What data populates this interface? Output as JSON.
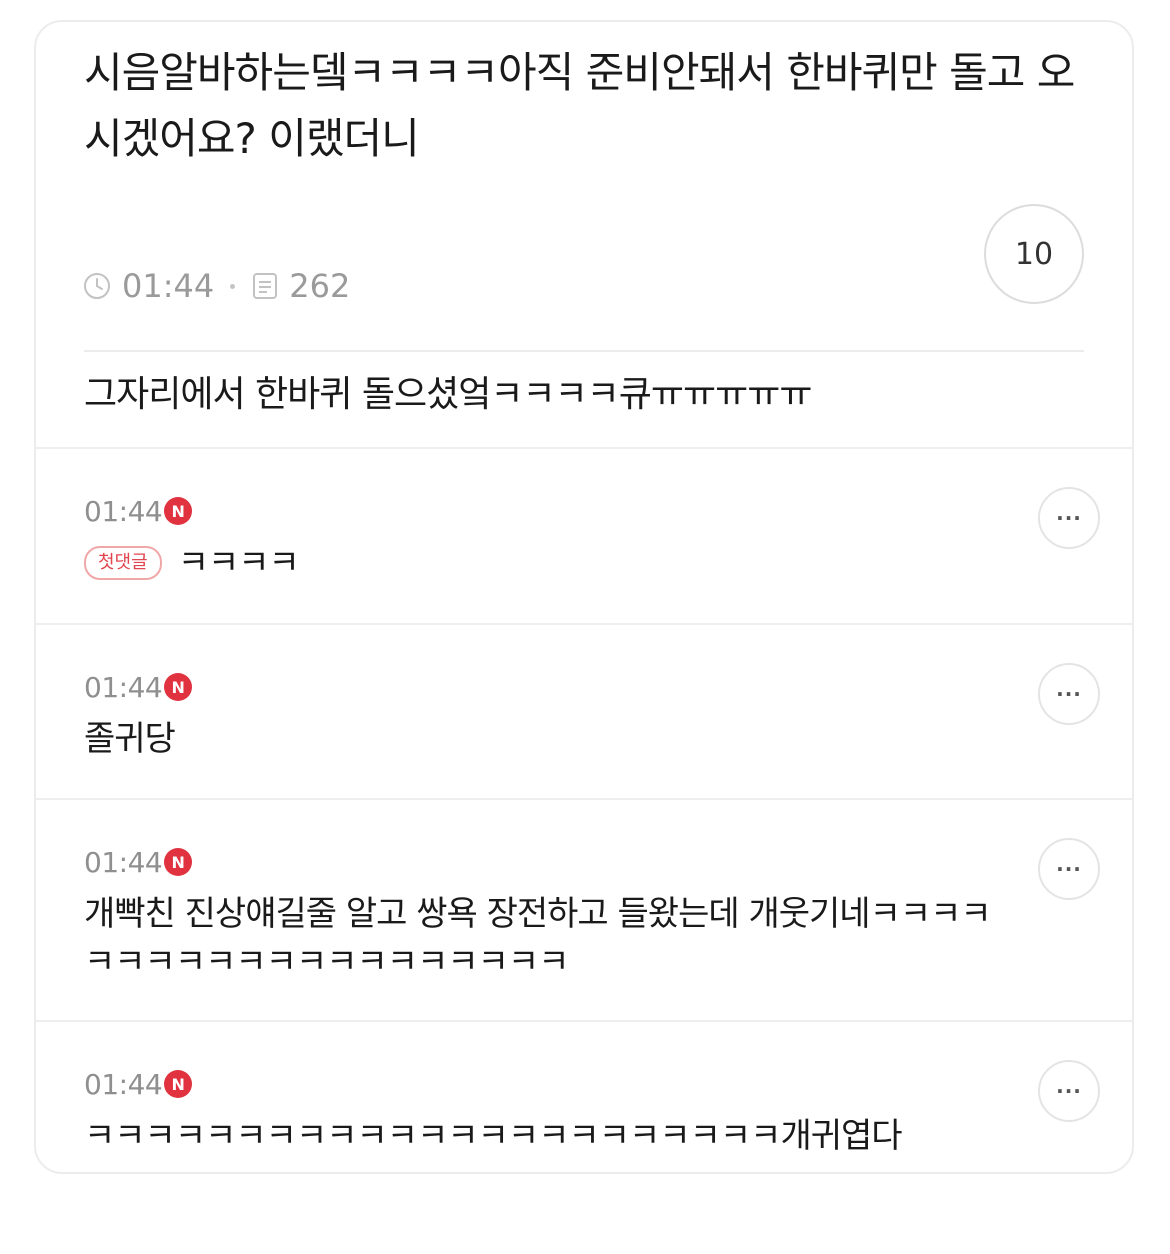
{
  "post": {
    "title": "시음알바하는뎈ㅋㅋㅋㅋ아직 준비안돼서 한바퀴만 돌고 오시겠어요? 이랬더니",
    "time": "01:44",
    "views": "262",
    "comment_count": "10",
    "body": "그자리에서 한바퀴 돌으셨엌ㅋㅋㅋㅋ큐ㅠㅠㅠㅠㅠ"
  },
  "comments": [
    {
      "time": "01:44",
      "badge": "N",
      "first_label": "첫댓글",
      "text": "ㅋㅋㅋㅋ",
      "more": "···"
    },
    {
      "time": "01:44",
      "badge": "N",
      "text": "졸귀당",
      "more": "···"
    },
    {
      "time": "01:44",
      "badge": "N",
      "text": "개빡친 진상얘길줄 알고 쌍욕 장전하고 들왔는데 개웃기네ㅋㅋㅋㅋㅋㅋㅋㅋㅋㅋㅋㅋㅋㅋㅋㅋㅋㅋㅋㅋ",
      "more": "···"
    },
    {
      "time": "01:44",
      "badge": "N",
      "text": "ㅋㅋㅋㅋㅋㅋㅋㅋㅋㅋㅋㅋㅋㅋㅋㅋㅋㅋㅋㅋㅋㅋㅋ개귀엽다",
      "more": "···"
    }
  ],
  "icons": {
    "clock": "clock-icon",
    "views": "document-icon",
    "more": "more-icon"
  },
  "colors": {
    "badge_red": "#e0323f",
    "meta_gray": "#9a9a9a",
    "first_badge": "#e0464f"
  }
}
